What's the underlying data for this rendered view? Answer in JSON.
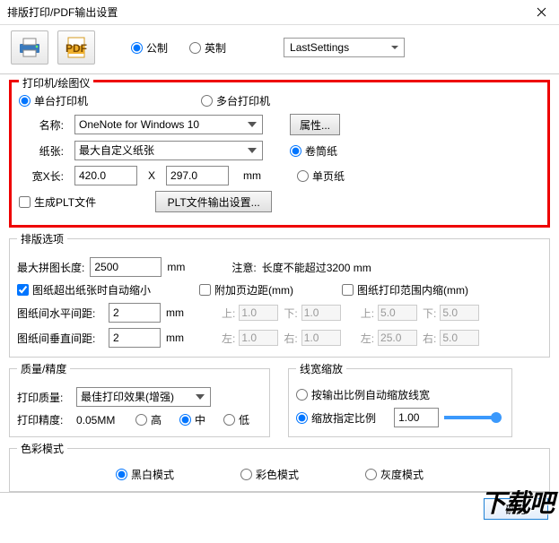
{
  "window": {
    "title": "排版打印/PDF输出设置"
  },
  "toolbar": {
    "units": {
      "metric": "公制",
      "imperial": "英制"
    },
    "settings": "LastSettings"
  },
  "printer_group": {
    "legend": "打印机/绘图仪",
    "mode": {
      "single": "单台打印机",
      "multi": "多台打印机"
    },
    "name_label": "名称:",
    "name_value": "OneNote for Windows 10",
    "props_btn": "属性...",
    "paper_label": "纸张:",
    "paper_value": "最大自定义纸张",
    "roll": "卷筒纸",
    "sheet": "单页纸",
    "size_label": "宽X长:",
    "width": "420.0",
    "height": "297.0",
    "x": "X",
    "mm": "mm",
    "plt_chk": "生成PLT文件",
    "plt_btn": "PLT文件输出设置..."
  },
  "layout_group": {
    "legend": "排版选项",
    "maxlen_label": "最大拼图长度:",
    "maxlen": "2500",
    "mm": "mm",
    "note_label": "注意:",
    "note_text": "长度不能超过3200 mm",
    "autoshrink": "图纸超出纸张时自动缩小",
    "addmargin": "附加页边距(mm)",
    "innermargin": "图纸打印范围内缩(mm)",
    "hgap_label": "图纸间水平间距:",
    "hgap": "2",
    "vgap_label": "图纸间垂直间距:",
    "vgap": "2",
    "top": "上:",
    "bottom": "下:",
    "left": "左:",
    "right": "右:",
    "v1": "1.0",
    "v5": "5.0",
    "v25": "25.0"
  },
  "quality_group": {
    "legend": "质量/精度",
    "pq_label": "打印质量:",
    "pq_value": "最佳打印效果(增强)",
    "pp_label": "打印精度:",
    "pp_value": "0.05MM",
    "high": "高",
    "mid": "中",
    "low": "低"
  },
  "linewidth_group": {
    "legend": "线宽缩放",
    "auto": "按输出比例自动缩放线宽",
    "fixed": "缩放指定比例",
    "ratio": "1.00"
  },
  "color_group": {
    "legend": "色彩模式",
    "bw": "黑白模式",
    "color": "彩色模式",
    "gray": "灰度模式"
  },
  "buttons": {
    "ok": "确定"
  },
  "watermark": "下载吧"
}
